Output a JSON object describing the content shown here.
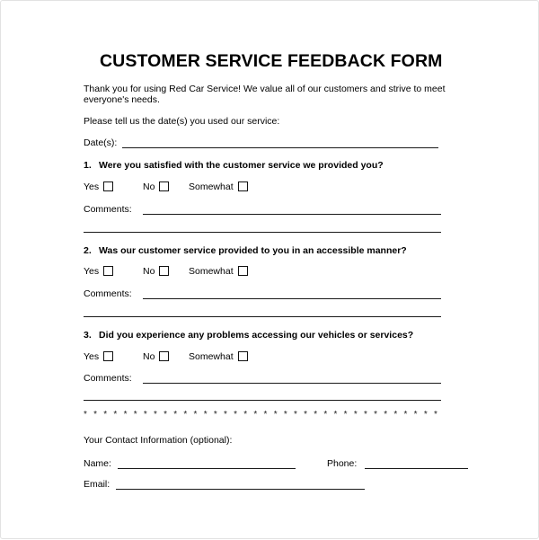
{
  "document": {
    "title": "CUSTOMER SERVICE FEEDBACK FORM",
    "intro": "Thank you for using Red Car Service!  We value all of our customers and strive to meet everyone's needs.",
    "date_prompt": "Please tell us the date(s) you used our service:",
    "date_label": "Date(s):",
    "divider_glyph": "*",
    "divider_repeat_count": 44
  },
  "choices": {
    "yes": "Yes",
    "no": "No",
    "somewhat": "Somewhat"
  },
  "comments_label": "Comments:",
  "questions": [
    {
      "number": "1.",
      "text": "Were you satisfied with the customer service we provided you?"
    },
    {
      "number": "2.",
      "text": "Was our customer service provided to you in an accessible manner?"
    },
    {
      "number": "3.",
      "text": "Did you experience any problems accessing our vehicles or services?"
    }
  ],
  "contact": {
    "heading": "Your Contact Information (optional):",
    "name_label": "Name:",
    "phone_label": "Phone:",
    "email_label": "Email:"
  },
  "values": {
    "date": "",
    "q1_comments": "",
    "q2_comments": "",
    "q3_comments": "",
    "name": "",
    "phone": "",
    "email": ""
  },
  "colors": {
    "ink": "#000000",
    "rule": "#1a1a1a",
    "page_border": "#e2e2e2",
    "paper": "#ffffff"
  }
}
